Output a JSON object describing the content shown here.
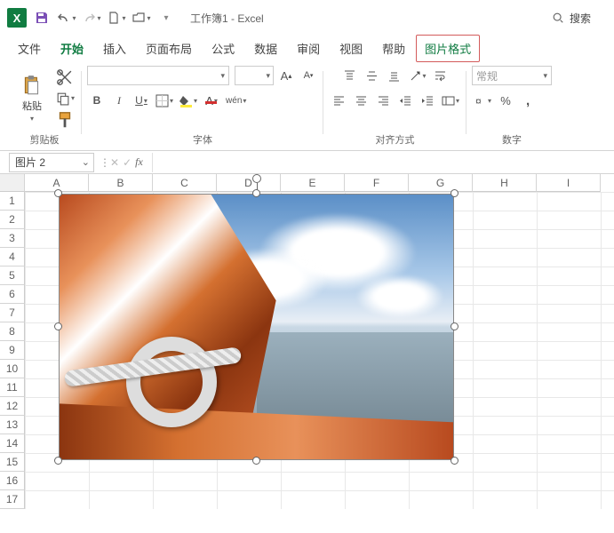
{
  "title": "工作簿1  -  Excel",
  "search_placeholder": "搜索",
  "tabs": {
    "file": "文件",
    "home": "开始",
    "insert": "插入",
    "layout": "页面布局",
    "formulas": "公式",
    "data": "数据",
    "review": "审阅",
    "view": "视图",
    "help": "帮助",
    "picfmt": "图片格式"
  },
  "ribbon": {
    "clipboard": {
      "paste": "粘贴",
      "label": "剪贴板"
    },
    "font": {
      "label": "字体",
      "bold": "B",
      "italic": "I",
      "underline": "U",
      "asian": "wén"
    },
    "align": {
      "label": "对齐方式"
    },
    "number": {
      "label": "数字",
      "style": "常规"
    }
  },
  "namebox": "图片 2",
  "columns": [
    "A",
    "B",
    "C",
    "D",
    "E",
    "F",
    "G",
    "H",
    "I"
  ],
  "rows": [
    "1",
    "2",
    "3",
    "4",
    "5",
    "6",
    "7",
    "8",
    "9",
    "10",
    "11",
    "12",
    "13",
    "14",
    "15",
    "16",
    "17"
  ]
}
